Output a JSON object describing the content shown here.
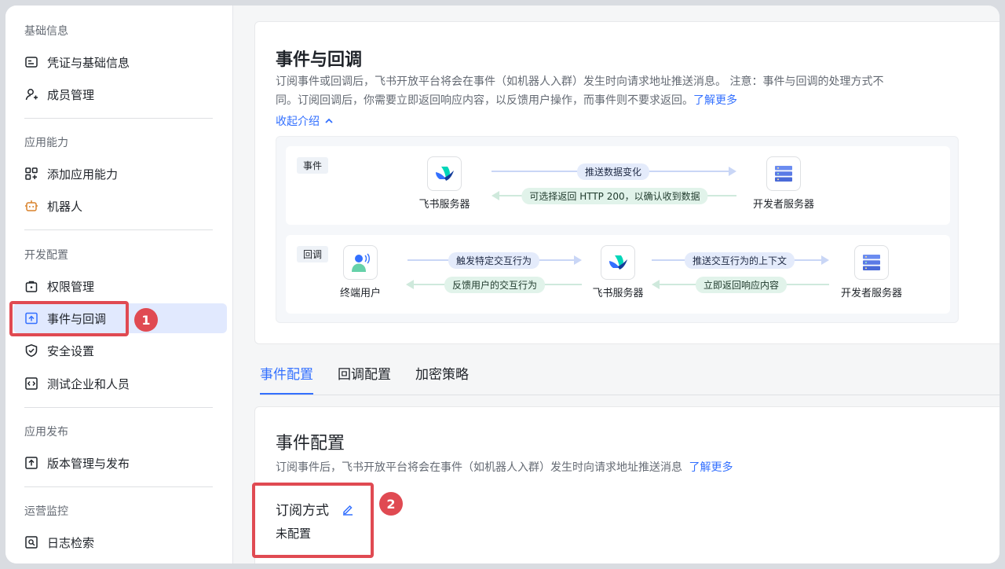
{
  "sidebar": {
    "sections": [
      {
        "title": "基础信息",
        "items": [
          "凭证与基础信息",
          "成员管理"
        ]
      },
      {
        "title": "应用能力",
        "items": [
          "添加应用能力",
          "机器人"
        ]
      },
      {
        "title": "开发配置",
        "items": [
          "权限管理",
          "事件与回调",
          "安全设置",
          "测试企业和人员"
        ]
      },
      {
        "title": "应用发布",
        "items": [
          "版本管理与发布"
        ]
      },
      {
        "title": "运营监控",
        "items": [
          "日志检索"
        ]
      }
    ],
    "active_item": "事件与回调"
  },
  "intro": {
    "title": "事件与回调",
    "desc_line1": "订阅事件或回调后，飞书开放平台将会在事件（如机器人入群）发生时向请求地址推送消息。 注意：事件与回调的处理方式不",
    "desc_line2": "同。订阅回调后，你需要立即返回响应内容，以反馈用户操作，而事件则不要求返回。",
    "learn_more": "了解更多",
    "collapse": "收起介绍"
  },
  "diagram": {
    "event": {
      "tag": "事件",
      "left_node": "飞书服务器",
      "right_node": "开发者服务器",
      "forward": "推送数据变化",
      "backward": "可选择返回 HTTP 200，以确认收到数据"
    },
    "callback": {
      "tag": "回调",
      "node1": "终端用户",
      "node2": "飞书服务器",
      "node3": "开发者服务器",
      "forward1": "触发特定交互行为",
      "backward1": "反馈用户的交互行为",
      "forward2": "推送交互行为的上下文",
      "backward2": "立即返回响应内容"
    }
  },
  "tabs": [
    "事件配置",
    "回调配置",
    "加密策略"
  ],
  "event_config": {
    "title": "事件配置",
    "desc": "订阅事件后，飞书开放平台将会在事件（如机器人入群）发生时向请求地址推送消息",
    "learn_more": "了解更多",
    "subscribe_label": "订阅方式",
    "subscribe_value": "未配置"
  },
  "annotations": {
    "badge1": "1",
    "badge2": "2"
  },
  "colors": {
    "accent": "#3370ff",
    "annotation_red": "#e04a52",
    "active_bg": "#e1e9fe"
  }
}
